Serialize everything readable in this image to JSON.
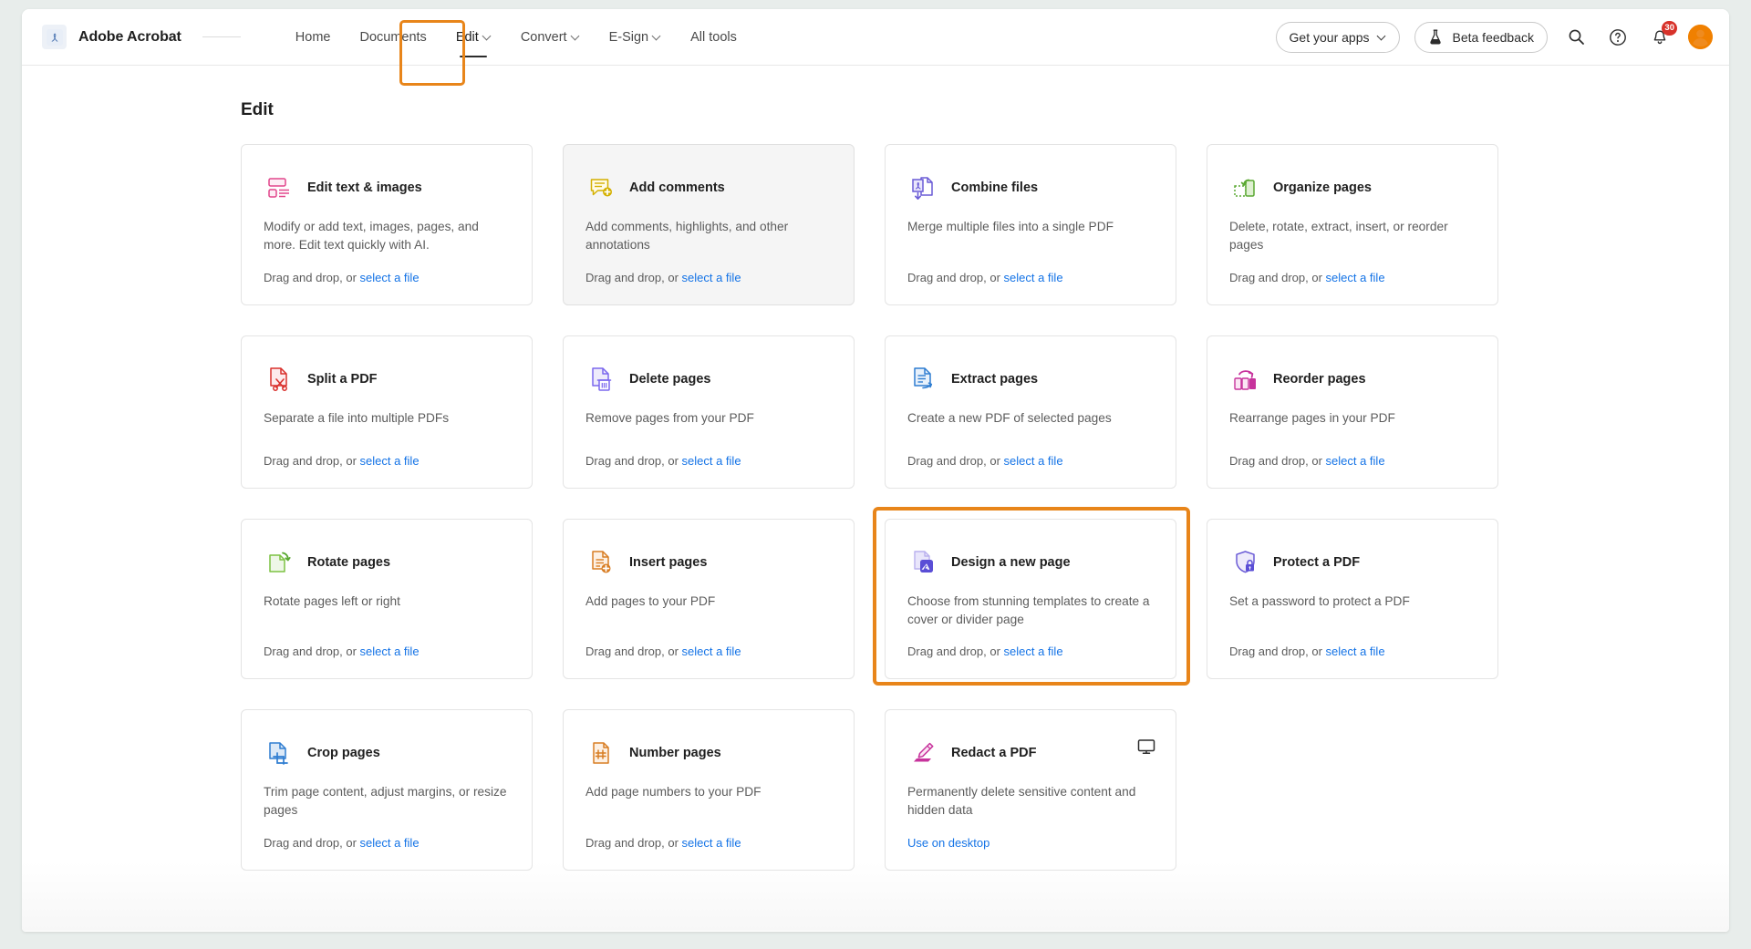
{
  "header": {
    "brand": "Adobe Acrobat",
    "logo_icon": "adobe-acrobat-logo",
    "nav": [
      {
        "label": "Home",
        "has_caret": false,
        "active": false
      },
      {
        "label": "Documents",
        "has_caret": false,
        "active": false
      },
      {
        "label": "Edit",
        "has_caret": true,
        "active": true,
        "highlighted": true
      },
      {
        "label": "Convert",
        "has_caret": true,
        "active": false
      },
      {
        "label": "E-Sign",
        "has_caret": true,
        "active": false
      },
      {
        "label": "All tools",
        "has_caret": false,
        "active": false
      }
    ],
    "get_your_apps": "Get your apps",
    "beta_feedback": "Beta feedback",
    "search_icon": "search-icon",
    "help_icon": "help-icon",
    "bell_icon": "notifications-bell-icon",
    "notification_count": "30",
    "avatar_icon": "user-avatar"
  },
  "main": {
    "title": "Edit",
    "drag_prefix": "Drag and drop, or ",
    "select_file_label": "select a file",
    "cards": [
      {
        "title": "Edit text & images",
        "desc": "Modify or add text, images, pages, and more. Edit text quickly with AI.",
        "icon": "edit-text-images-icon",
        "action": "drag-drop",
        "hovered": false
      },
      {
        "title": "Add comments",
        "desc": "Add comments, highlights, and other annotations",
        "icon": "add-comments-icon",
        "action": "drag-drop",
        "hovered": true
      },
      {
        "title": "Combine files",
        "desc": "Merge multiple files into a single PDF",
        "icon": "combine-files-icon",
        "action": "drag-drop",
        "hovered": false
      },
      {
        "title": "Organize pages",
        "desc": "Delete, rotate, extract, insert, or reorder pages",
        "icon": "organize-pages-icon",
        "action": "drag-drop",
        "hovered": false
      },
      {
        "title": "Split a PDF",
        "desc": "Separate a file into multiple PDFs",
        "icon": "split-pdf-icon",
        "action": "drag-drop",
        "hovered": false
      },
      {
        "title": "Delete pages",
        "desc": "Remove pages from your PDF",
        "icon": "delete-pages-icon",
        "action": "drag-drop",
        "hovered": false
      },
      {
        "title": "Extract pages",
        "desc": "Create a new PDF of selected pages",
        "icon": "extract-pages-icon",
        "action": "drag-drop",
        "hovered": false
      },
      {
        "title": "Reorder pages",
        "desc": "Rearrange pages in your PDF",
        "icon": "reorder-pages-icon",
        "action": "drag-drop",
        "hovered": false
      },
      {
        "title": "Rotate pages",
        "desc": "Rotate pages left or right",
        "icon": "rotate-pages-icon",
        "action": "drag-drop",
        "hovered": false
      },
      {
        "title": "Insert pages",
        "desc": "Add pages to your PDF",
        "icon": "insert-pages-icon",
        "action": "drag-drop",
        "hovered": false
      },
      {
        "title": "Design a new page",
        "desc": "Choose from stunning templates to create a cover or divider page",
        "icon": "design-new-page-icon",
        "action": "drag-drop",
        "hovered": false,
        "highlighted": true
      },
      {
        "title": "Protect a PDF",
        "desc": "Set a password to protect a PDF",
        "icon": "protect-pdf-icon",
        "action": "drag-drop",
        "hovered": false
      },
      {
        "title": "Crop pages",
        "desc": "Trim page content, adjust margins, or resize pages",
        "icon": "crop-pages-icon",
        "action": "drag-drop",
        "hovered": false
      },
      {
        "title": "Number pages",
        "desc": "Add page numbers to your PDF",
        "icon": "number-pages-icon",
        "action": "drag-drop",
        "hovered": false
      },
      {
        "title": "Redact a PDF",
        "desc": "Permanently delete sensitive content and hidden data",
        "icon": "redact-pdf-icon",
        "action": "use-on-desktop",
        "use_on_desktop_label": "Use on desktop",
        "desktop_icon": "desktop-monitor-icon",
        "hovered": false
      }
    ]
  },
  "colors": {
    "highlight": "#e8851a",
    "link": "#1473e6",
    "badge": "#d7322a",
    "avatar": "#f08000"
  }
}
